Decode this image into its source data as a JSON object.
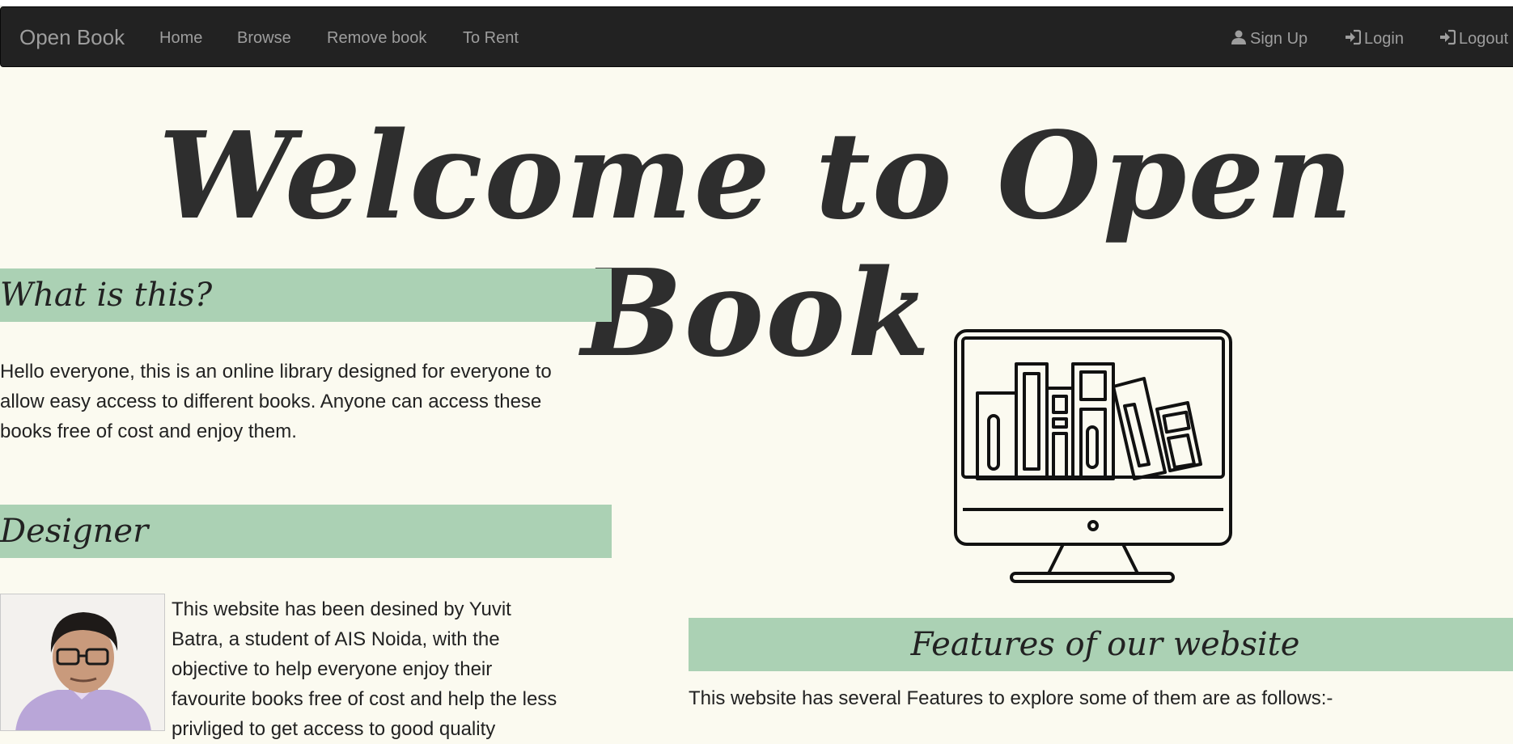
{
  "navbar": {
    "brand": "Open Book",
    "links": [
      "Home",
      "Browse",
      "Remove book",
      "To Rent"
    ],
    "right": [
      {
        "label": "Sign Up",
        "icon": "user-icon"
      },
      {
        "label": "Login",
        "icon": "login-icon"
      },
      {
        "label": "Logout",
        "icon": "logout-icon"
      }
    ]
  },
  "hero": {
    "title": "Welcome to Open Book"
  },
  "about": {
    "heading": "What is this?",
    "lines": [
      "Hello everyone, this is an online library designed for everyone to",
      "allow easy access to different books. Anyone can access these",
      "books free of cost and enjoy them."
    ]
  },
  "designer": {
    "heading": "Designer",
    "lines": [
      "This website has been desined by Yuvit",
      "Batra, a student of AIS Noida, with the",
      "objective to help everyone enjoy their",
      "favourite books free of cost and help the less",
      "privliged to get access to good quality"
    ]
  },
  "features": {
    "heading": "Features of our website",
    "intro": "This website has several Features to explore some of them are as follows:-"
  },
  "colors": {
    "navbar": "#222222",
    "section_bar": "#abd1b4",
    "background": "#fbfaf0"
  }
}
